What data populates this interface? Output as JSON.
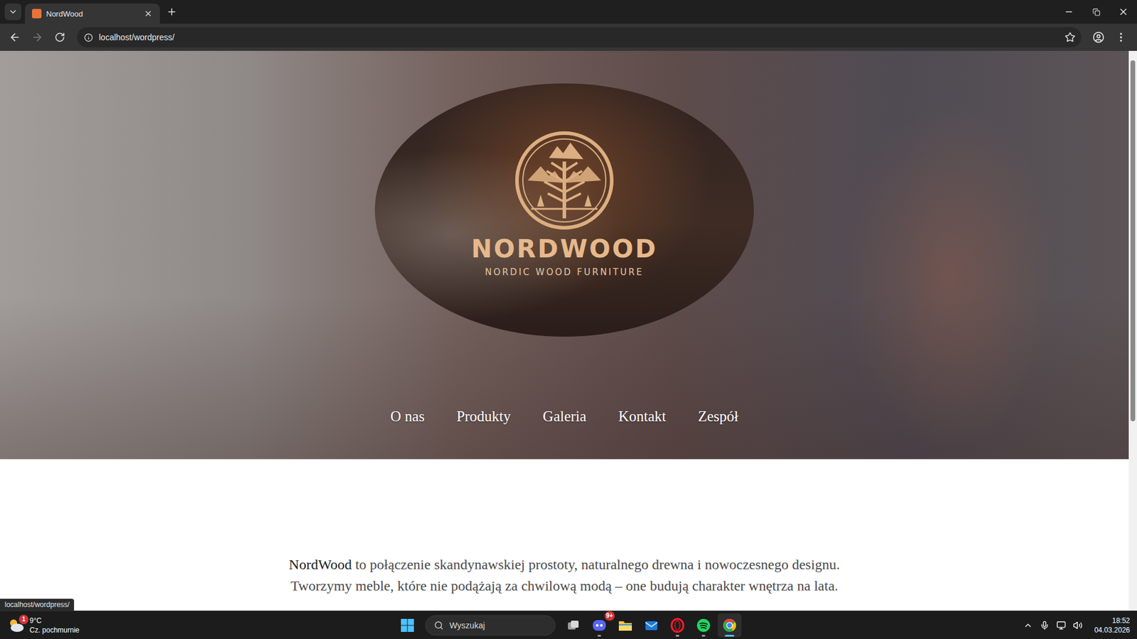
{
  "browser": {
    "tabs": [
      {
        "title": "NordWood",
        "close": "×",
        "selected": true
      }
    ],
    "nav_buttons": [
      {
        "kind": "back",
        "disabled": false
      },
      {
        "kind": "forward",
        "disabled": true
      },
      {
        "kind": "reload",
        "disabled": false
      }
    ],
    "url": "localhost/wordpress/"
  },
  "hero": {
    "logo": {
      "name": "NORDWOOD",
      "tagline": "NORDIC WOOD FURNITURE"
    },
    "nav": [
      {
        "label": "O nas"
      },
      {
        "label": "Produkty"
      },
      {
        "label": "Galeria"
      },
      {
        "label": "Kontakt"
      },
      {
        "label": "Zespół"
      }
    ]
  },
  "content": {
    "lines": [
      [
        {
          "text": "NordWood",
          "emphasis": true
        },
        {
          "text": " to połączenie skandynawskiej prostoty, naturalnego drewna i nowoczesnego designu.",
          "emphasis": false
        }
      ],
      [
        {
          "text": "Tworzymy meble, które nie podążają za chwilową modą – one budują charakter wnętrza na lata.",
          "emphasis": false
        }
      ]
    ]
  },
  "status_link": "localhost/wordpress/",
  "taskbar": {
    "weather": {
      "temp": "9°C",
      "desc": "Cz. pochmurnie",
      "badge": "1"
    },
    "search": "Wyszukaj",
    "apps": [
      {
        "kind": "taskview",
        "badge": "",
        "running": false,
        "active": false
      },
      {
        "kind": "discord",
        "badge": "9+",
        "running": true,
        "active": false
      },
      {
        "kind": "files",
        "badge": "",
        "running": false,
        "active": false
      },
      {
        "kind": "mail",
        "badge": "",
        "running": false,
        "active": false
      },
      {
        "kind": "opera",
        "badge": "",
        "running": true,
        "active": false
      },
      {
        "kind": "spotify",
        "badge": "",
        "running": true,
        "active": false
      },
      {
        "kind": "chrome",
        "badge": "",
        "running": true,
        "active": true
      }
    ],
    "clock": {
      "time": "18:52",
      "date": "04.03.2026"
    }
  }
}
